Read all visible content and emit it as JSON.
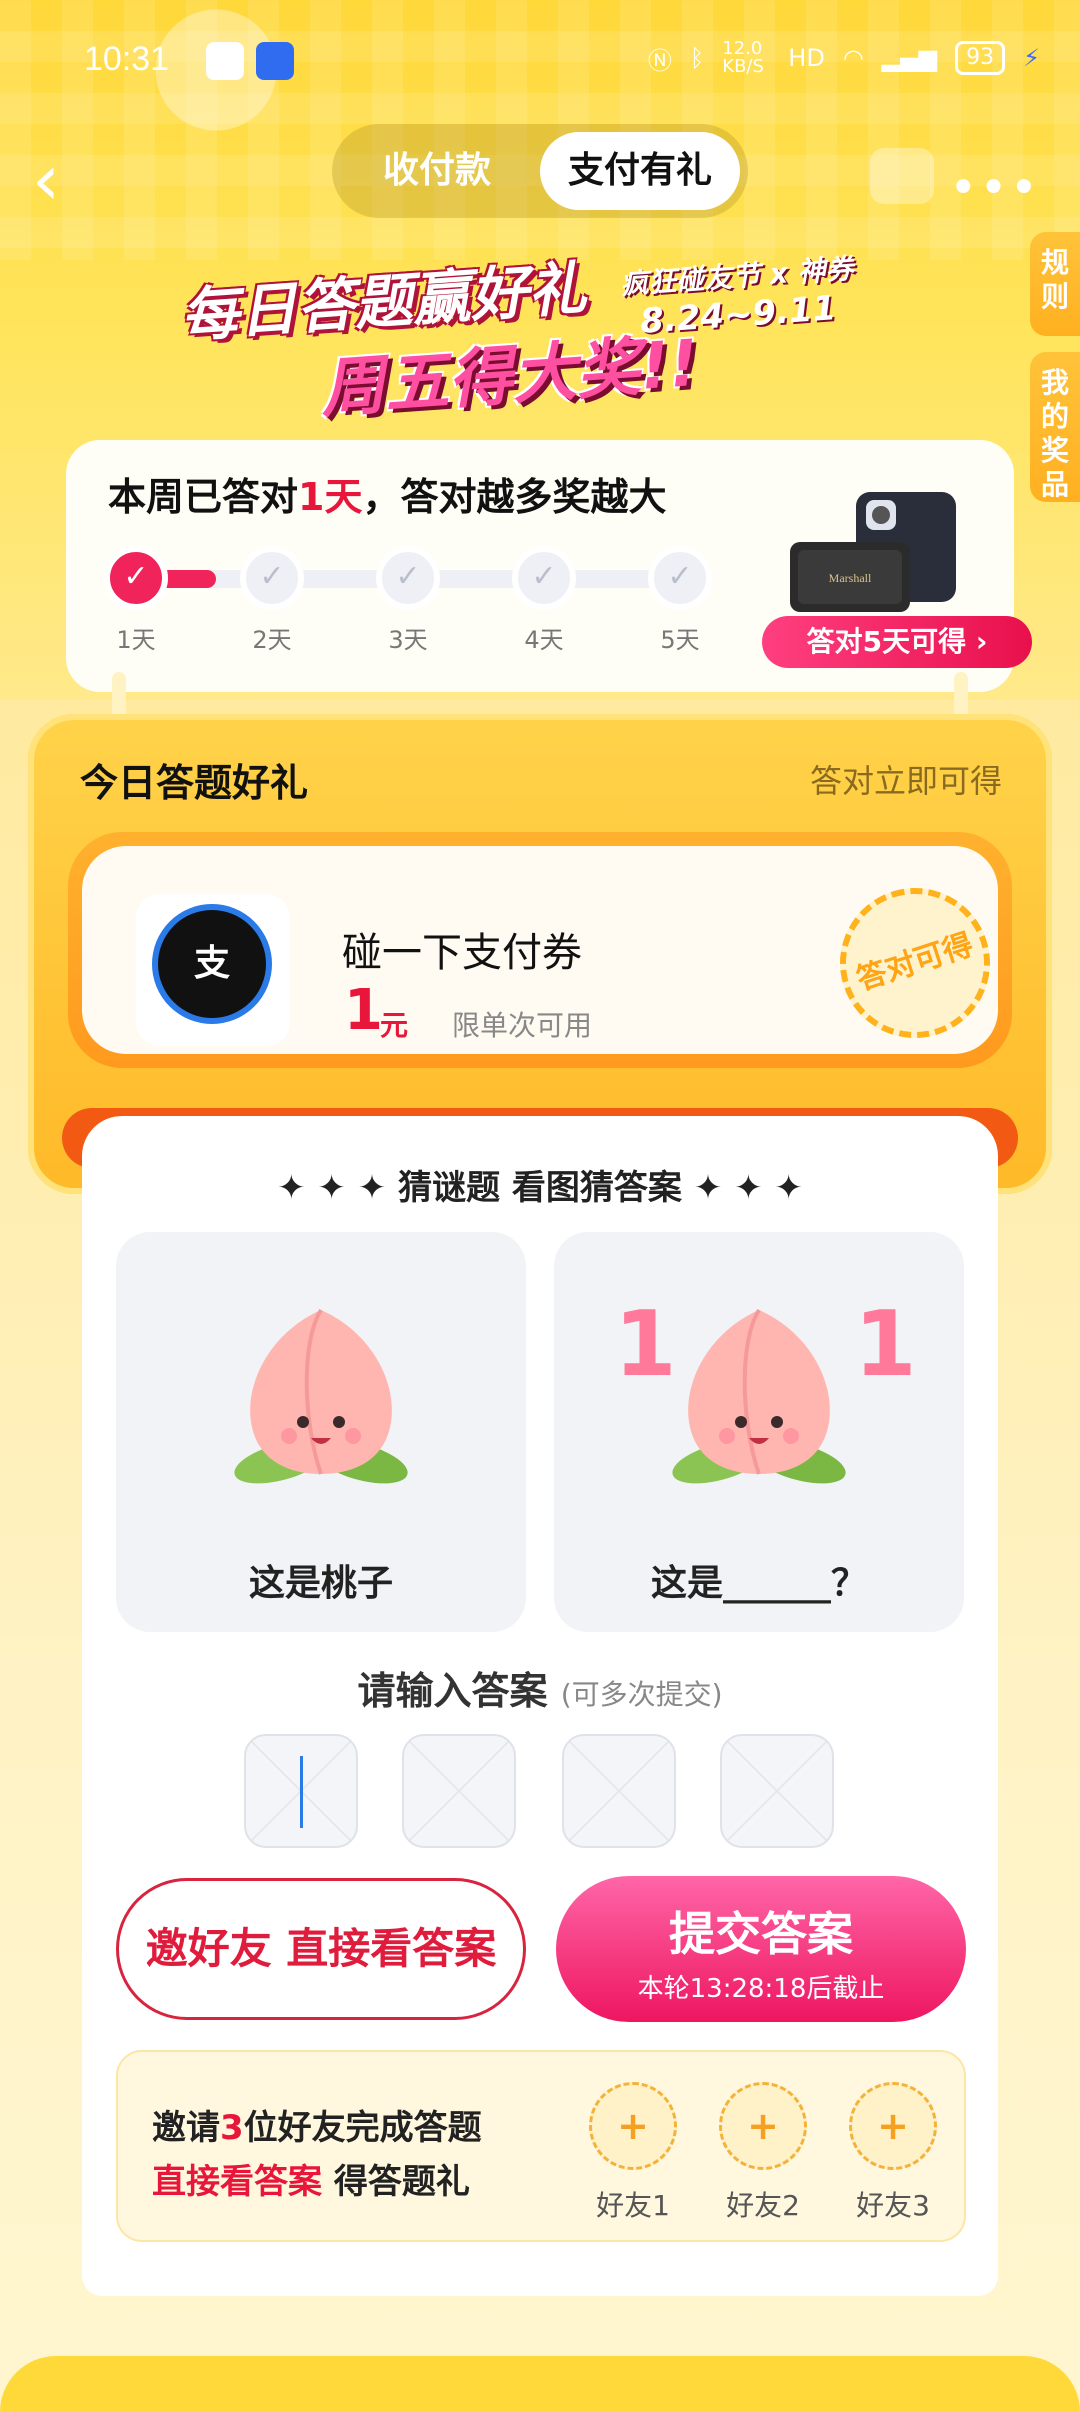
{
  "status": {
    "time": "10:31",
    "speed": "12.0 KB/S",
    "battery": "93"
  },
  "nav": {
    "tab_receive": "收付款",
    "tab_gift": "支付有礼"
  },
  "side": {
    "rules": "规则",
    "my_prizes": "我的奖品"
  },
  "banner": {
    "line1": "每日答题赢好礼",
    "line2": "周五得大奖!!",
    "tag": "疯狂碰友节 x 神券",
    "date": "8.24~9.11"
  },
  "progress": {
    "title_prefix": "本周已答对",
    "title_highlight": "1天",
    "title_suffix": "，答对越多奖越大",
    "days": [
      "1天",
      "2天",
      "3天",
      "4天",
      "5天"
    ],
    "completed": 1,
    "prize_button": "答对5天可得 ›"
  },
  "today": {
    "heading": "今日答题好礼",
    "subheading": "答对立即可得",
    "coupon_icon": "支",
    "coupon_title": "碰一下支付券",
    "coupon_amount": "1",
    "coupon_unit": "元",
    "coupon_note": "限单次可用",
    "stamp": "答对可得"
  },
  "quiz": {
    "heading": "✦ ✦ ✦  猜谜题 看图猜答案  ✦ ✦ ✦",
    "card1_caption": "这是桃子",
    "card2_caption": "这是______？",
    "input_label": "请输入答案",
    "input_hint": "(可多次提交)",
    "invite_button": "邀好友 直接看答案",
    "submit_button": "提交答案",
    "submit_deadline": "本轮13:28:18后截止"
  },
  "invite": {
    "line1_prefix": "邀请",
    "line1_num": "3",
    "line1_suffix": "位好友完成答题",
    "line2_highlight": "直接看答案",
    "line2_suffix": " 得答题礼",
    "friends": [
      "好友1",
      "好友2",
      "好友3"
    ],
    "plus": "+"
  },
  "colors": {
    "accent": "#e8163a",
    "brand_yellow": "#ffd83a",
    "submit_pink": "#ee1660"
  }
}
